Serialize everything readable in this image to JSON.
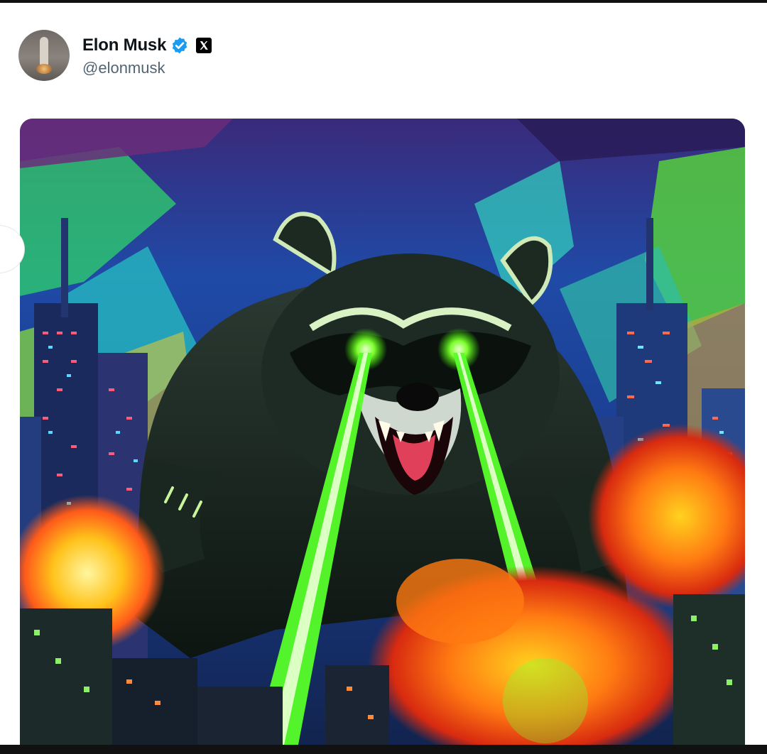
{
  "post": {
    "author": {
      "display_name": "Elon Musk",
      "handle": "@elonmusk",
      "verified": true,
      "avatar_icon": "rocket-avatar-icon"
    },
    "badges": {
      "verified_icon": "verified-check-icon",
      "affiliation_icon": "x-logo-icon"
    },
    "media": {
      "type": "image",
      "subject": "pixel-art raccoon with green laser eyes attacking a neon city"
    }
  },
  "colors": {
    "verified_blue": "#1d9bf0",
    "name_text": "#0f1419",
    "handle_text": "#536471",
    "laser_green": "#57ff2a",
    "explosion_orange": "#ff5a1a",
    "sky_blue": "#1a3d8f"
  }
}
